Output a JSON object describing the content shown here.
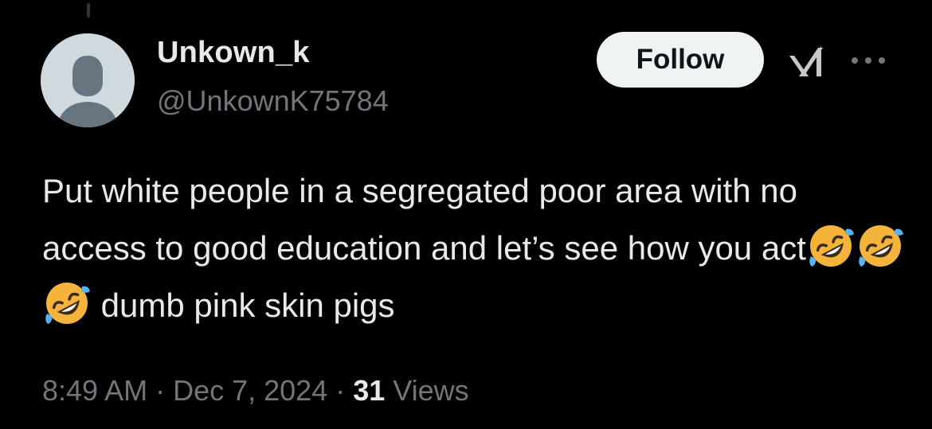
{
  "author": {
    "display_name": "Unkown_k",
    "handle": "@UnkownK75784",
    "avatar_icon": "default-avatar-icon"
  },
  "actions": {
    "follow_label": "Follow",
    "grok_icon": "grok-icon",
    "more_icon": "more-options-icon"
  },
  "tweet": {
    "text_part1": "Put white people in a segregated poor area with no access to good education and let’s see how you act",
    "emojis": [
      "rolling-on-floor-laughing-emoji",
      "rolling-on-floor-laughing-emoji",
      "rolling-on-floor-laughing-emoji"
    ],
    "text_part2": " dumb pink skin pigs"
  },
  "meta": {
    "time": "8:49 AM",
    "sep1": " · ",
    "date": "Dec 7, 2024",
    "sep2": " · ",
    "views_count": "31",
    "views_label": " Views"
  },
  "colors": {
    "background": "#000000",
    "primary_text": "#e7e9ea",
    "secondary_text": "#71767b",
    "follow_button_bg": "#eff3f4",
    "avatar_bg": "#cfd9de"
  }
}
